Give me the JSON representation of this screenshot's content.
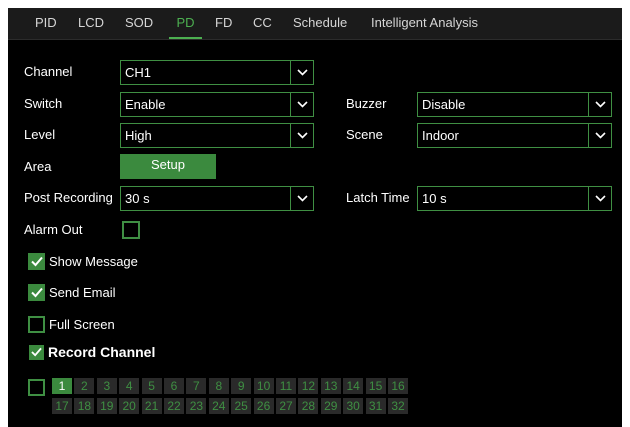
{
  "tabs": [
    {
      "label": "PID",
      "active": false
    },
    {
      "label": "LCD",
      "active": false
    },
    {
      "label": "SOD",
      "active": false
    },
    {
      "label": "PD",
      "active": true
    },
    {
      "label": "FD",
      "active": false
    },
    {
      "label": "CC",
      "active": false
    },
    {
      "label": "Schedule",
      "active": false
    },
    {
      "label": "Intelligent Analysis",
      "active": false
    }
  ],
  "form": {
    "channel": {
      "label": "Channel",
      "value": "CH1"
    },
    "switch": {
      "label": "Switch",
      "value": "Enable"
    },
    "level": {
      "label": "Level",
      "value": "High"
    },
    "area": {
      "label": "Area",
      "button": "Setup"
    },
    "post_recording": {
      "label": "Post Recording",
      "value": "30 s"
    },
    "alarm_out": {
      "label": "Alarm Out",
      "checked": false
    },
    "buzzer": {
      "label": "Buzzer",
      "value": "Disable"
    },
    "scene": {
      "label": "Scene",
      "value": "Indoor"
    },
    "latch_time": {
      "label": "Latch Time",
      "value": "10 s"
    }
  },
  "options": {
    "show_message": {
      "label": "Show Message",
      "checked": true
    },
    "send_email": {
      "label": "Send Email",
      "checked": true
    },
    "full_screen": {
      "label": "Full Screen",
      "checked": false
    },
    "record_channel": {
      "label": "Record Channel",
      "checked": true
    }
  },
  "record_channels": {
    "select_all_checked": false,
    "row1": [
      "1",
      "2",
      "3",
      "4",
      "5",
      "6",
      "7",
      "8",
      "9",
      "10",
      "11",
      "12",
      "13",
      "14",
      "15",
      "16"
    ],
    "row2": [
      "17",
      "18",
      "19",
      "20",
      "21",
      "22",
      "23",
      "24",
      "25",
      "26",
      "27",
      "28",
      "29",
      "30",
      "31",
      "32"
    ],
    "selected": [
      "1"
    ]
  },
  "colors": {
    "accent": "#3b8a3e",
    "border": "#3f8f43",
    "background": "#000000",
    "tabbar": "#1b1b1b"
  },
  "icons": {
    "dropdown": "chevron-down-icon",
    "check": "checkmark-icon"
  }
}
